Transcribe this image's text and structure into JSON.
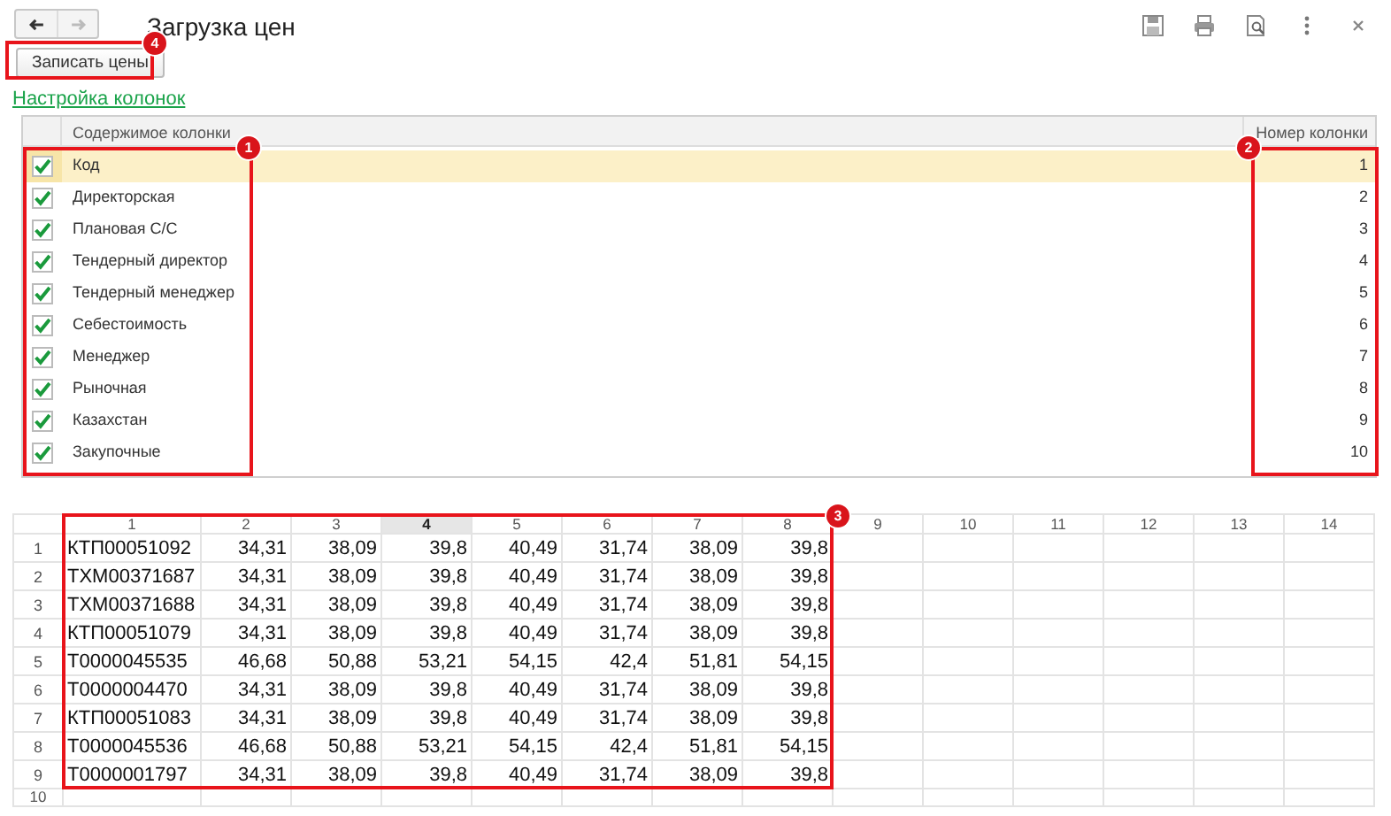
{
  "window": {
    "title": "Загрузка цен"
  },
  "nav": [
    {
      "kind": "back",
      "disabled": false
    },
    {
      "kind": "forward",
      "disabled": true
    }
  ],
  "button": {
    "label": "Записать цены",
    "callout": "4"
  },
  "link": "Настройка колонок",
  "columns_table": {
    "columns": [
      "Содержимое колонки",
      "Номер колонки"
    ],
    "name_callout": "1",
    "number_callout": "2",
    "rows": [
      {
        "checked": true,
        "name": "Код",
        "number": "1",
        "selected": true
      },
      {
        "checked": true,
        "name": "Директорская",
        "number": "2",
        "selected": false
      },
      {
        "checked": true,
        "name": "Плановая С/С",
        "number": "3",
        "selected": false
      },
      {
        "checked": true,
        "name": "Тендерный директор",
        "number": "4",
        "selected": false
      },
      {
        "checked": true,
        "name": "Тендерный менеджер",
        "number": "5",
        "selected": false
      },
      {
        "checked": true,
        "name": "Себестоимость",
        "number": "6",
        "selected": false
      },
      {
        "checked": true,
        "name": "Менеджер",
        "number": "7",
        "selected": false
      },
      {
        "checked": true,
        "name": "Рыночная",
        "number": "8",
        "selected": false
      },
      {
        "checked": true,
        "name": "Казахстан",
        "number": "9",
        "selected": false
      },
      {
        "checked": true,
        "name": "Закупочные",
        "number": "10",
        "selected": false
      }
    ]
  },
  "sheet": {
    "callout": "3",
    "columns": [
      {
        "label": "1",
        "selected": false
      },
      {
        "label": "2",
        "selected": false
      },
      {
        "label": "3",
        "selected": false
      },
      {
        "label": "4",
        "selected": true
      },
      {
        "label": "5",
        "selected": false
      },
      {
        "label": "6",
        "selected": false
      },
      {
        "label": "7",
        "selected": false
      },
      {
        "label": "8",
        "selected": false
      },
      {
        "label": "9",
        "selected": false
      },
      {
        "label": "10",
        "selected": false
      },
      {
        "label": "11",
        "selected": false
      },
      {
        "label": "12",
        "selected": false
      },
      {
        "label": "13",
        "selected": false
      },
      {
        "label": "14",
        "selected": false
      }
    ],
    "rows": [
      {
        "label": "1",
        "cells": [
          "КТП00051092",
          "34,31",
          "38,09",
          "39,8",
          "40,49",
          "31,74",
          "38,09",
          "39,8"
        ]
      },
      {
        "label": "2",
        "cells": [
          "ТХМ00371687",
          "34,31",
          "38,09",
          "39,8",
          "40,49",
          "31,74",
          "38,09",
          "39,8"
        ]
      },
      {
        "label": "3",
        "cells": [
          "ТХМ00371688",
          "34,31",
          "38,09",
          "39,8",
          "40,49",
          "31,74",
          "38,09",
          "39,8"
        ]
      },
      {
        "label": "4",
        "cells": [
          "КТП00051079",
          "34,31",
          "38,09",
          "39,8",
          "40,49",
          "31,74",
          "38,09",
          "39,8"
        ]
      },
      {
        "label": "5",
        "cells": [
          "Т0000045535",
          "46,68",
          "50,88",
          "53,21",
          "54,15",
          "42,4",
          "51,81",
          "54,15"
        ]
      },
      {
        "label": "6",
        "cells": [
          "Т0000004470",
          "34,31",
          "38,09",
          "39,8",
          "40,49",
          "31,74",
          "38,09",
          "39,8"
        ]
      },
      {
        "label": "7",
        "cells": [
          "КТП00051083",
          "34,31",
          "38,09",
          "39,8",
          "40,49",
          "31,74",
          "38,09",
          "39,8"
        ]
      },
      {
        "label": "8",
        "cells": [
          "Т0000045536",
          "46,68",
          "50,88",
          "53,21",
          "54,15",
          "42,4",
          "51,81",
          "54,15"
        ]
      },
      {
        "label": "9",
        "cells": [
          "Т0000001797",
          "34,31",
          "38,09",
          "39,8",
          "40,49",
          "31,74",
          "38,09",
          "39,8"
        ]
      },
      {
        "label": "10"
      }
    ]
  }
}
